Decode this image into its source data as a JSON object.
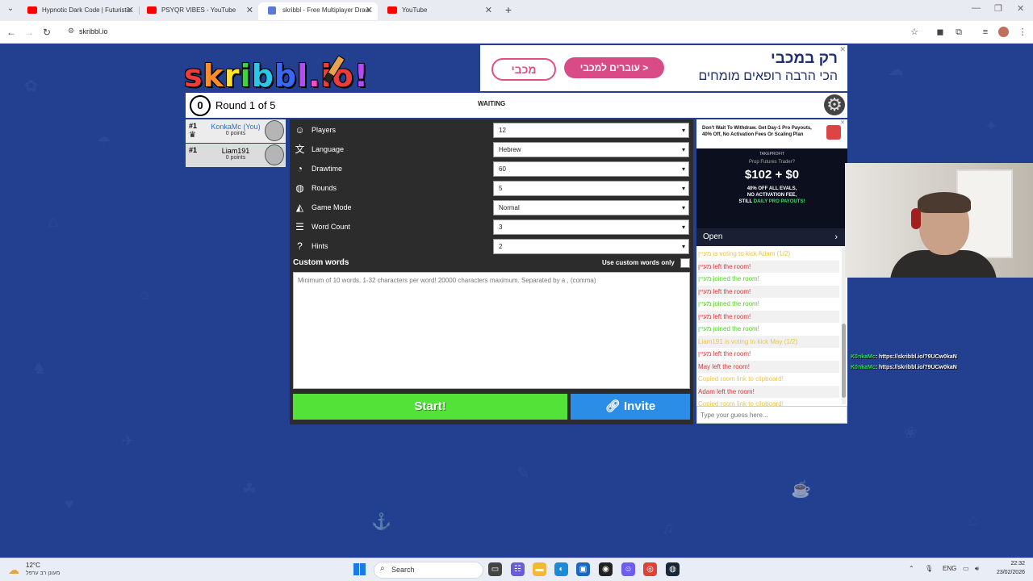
{
  "browser": {
    "tabs": [
      {
        "title": "Hypnotic Dark Code | Futuristic",
        "fav_color": "#ff0000"
      },
      {
        "title": "PSYQR VIBES - YouTube",
        "fav_color": "#ff0000"
      },
      {
        "title": "skribbl - Free Multiplayer Draw",
        "fav_color": "#5b7ad6",
        "active": true
      },
      {
        "title": "YouTube",
        "fav_color": "#ff0000"
      }
    ],
    "url": "skribbl.io"
  },
  "game": {
    "logo": {
      "l1": "s",
      "l2": "k",
      "l3": "r",
      "l4": "i",
      "l5": "b",
      "l6": "b",
      "l7": "l",
      "l8": ".",
      "l9": "io",
      "l10": "!"
    },
    "timer": "0",
    "round_text": "Round 1 of 5",
    "status": "WAITING",
    "players": [
      {
        "rank": "#1",
        "name": "KonkaMc (You)",
        "points": "0 points",
        "is_me": true
      },
      {
        "rank": "#1",
        "name": "Liam191",
        "points": "0 points",
        "is_me": false
      }
    ],
    "settings": [
      {
        "label": "Players",
        "value": "12",
        "icon": "user-icon"
      },
      {
        "label": "Language",
        "value": "Hebrew",
        "icon": "language-icon"
      },
      {
        "label": "Drawtime",
        "value": "60",
        "icon": "clock-icon"
      },
      {
        "label": "Rounds",
        "value": "5",
        "icon": "rounds-icon"
      },
      {
        "label": "Game Mode",
        "value": "Normal",
        "icon": "gamemode-icon"
      },
      {
        "label": "Word Count",
        "value": "3",
        "icon": "wordcount-icon"
      },
      {
        "label": "Hints",
        "value": "2",
        "icon": "hint-icon"
      }
    ],
    "custom_words_label": "Custom words",
    "custom_words_only_label": "Use custom words only",
    "custom_words_placeholder": "Minimum of 10 words. 1-32 characters per word! 20000 characters maximum. Separated by a , (comma)",
    "start_label": "Start!",
    "invite_label": "Invite",
    "guess_placeholder": "Type your guess here...",
    "chat": [
      {
        "text": "מעיין is voting to kick Adam (1/2)",
        "color": "#e8c64a"
      },
      {
        "text": "מעיין left the room!",
        "color": "#d43b3b"
      },
      {
        "text": "מעיין joined the room!",
        "color": "#56ce27"
      },
      {
        "text": "מעיין left the room!",
        "color": "#d43b3b"
      },
      {
        "text": "מעיין joined the room!",
        "color": "#56ce27"
      },
      {
        "text": "מעיין left the room!",
        "color": "#d43b3b"
      },
      {
        "text": "מעיין joined the room!",
        "color": "#56ce27"
      },
      {
        "text": "Liam191 is voting to kick May (1/2)",
        "color": "#e8c64a"
      },
      {
        "text": "מעיין left the room!",
        "color": "#d43b3b"
      },
      {
        "text": "May left the room!",
        "color": "#d43b3b"
      },
      {
        "text": "Copied room link to clipboard!",
        "color": "#e8c64a"
      },
      {
        "text": "Adam left the room!",
        "color": "#d43b3b"
      },
      {
        "text": "Copied room link to clipboard!",
        "color": "#e8c64a"
      }
    ]
  },
  "ads": {
    "top": {
      "brand": "מכבי",
      "cta": "עוברים למכבי >",
      "headline": "רק במכבי",
      "subline": "הכי הרבה רופאים מומחים"
    },
    "side": {
      "text": "Don't Wait To Withdraw. Get Day-1 Pro Payouts, 40% Off, No Activation Fees Or Scaling Plan",
      "firm": "TAKEPROFIT",
      "tag": "Prop Futures Trader?",
      "price": "$102 + $0",
      "sub1": "40% OFF ALL EVALS,",
      "sub2": "NO ACTIVATION FEE,",
      "sub3_plain": "STILL ",
      "sub3_hl": "DAILY PRO PAYOUTS!",
      "open": "Open"
    }
  },
  "stream_chat": [
    {
      "user": "K0nkaMc",
      "msg": ": https://skribbl.io/?9UCw0kaN"
    },
    {
      "user": "K0nkaMc",
      "msg": ": https://skribbl.io/?9UCw0kaN"
    }
  ],
  "taskbar": {
    "temp": "12°C",
    "weather_desc": "מעונן רב ערפל",
    "search": "Search",
    "lang": "ENG",
    "time": "22:32",
    "date": "23/02/2026"
  }
}
